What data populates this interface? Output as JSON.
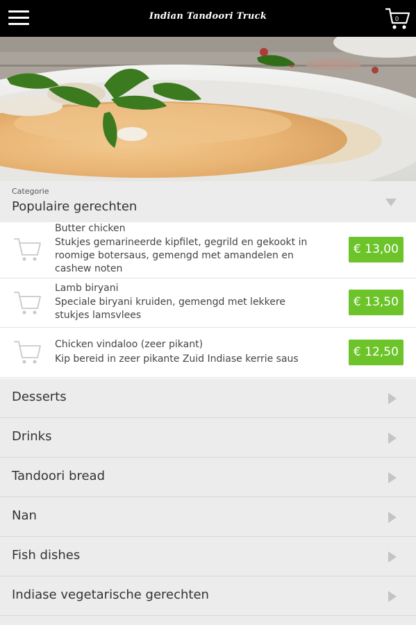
{
  "header": {
    "brand": "Indian Tandoori Truck",
    "cart_count": "0",
    "menu_icon": "hamburger-menu-icon",
    "cart_icon": "shopping-cart-icon"
  },
  "category": {
    "label": "Categorie",
    "selected": "Populaire gerechten"
  },
  "dishes": [
    {
      "name": "Butter chicken",
      "description": "Stukjes gemarineerde kipfilet, gegrild en gekookt in roomige botersaus, gemengd met amandelen en cashew noten",
      "price": "€ 13,00"
    },
    {
      "name": "Lamb biryani",
      "description": "Speciale biryani kruiden, gemengd met lekkere stukjes lamsvlees",
      "price": "€ 13,50"
    },
    {
      "name": "Chicken vindaloo (zeer pikant)",
      "description": "Kip bereid in zeer pikante Zuid Indiase kerrie saus",
      "price": "€ 12,50"
    }
  ],
  "categories": [
    {
      "label": "Desserts"
    },
    {
      "label": "Drinks"
    },
    {
      "label": "Tandoori bread"
    },
    {
      "label": "Nan"
    },
    {
      "label": "Fish dishes"
    },
    {
      "label": "Indiase vegetarische gerechten"
    }
  ],
  "colors": {
    "topbar": "#000000",
    "price_badge": "#6cc42a",
    "category_bg": "#ececec"
  }
}
